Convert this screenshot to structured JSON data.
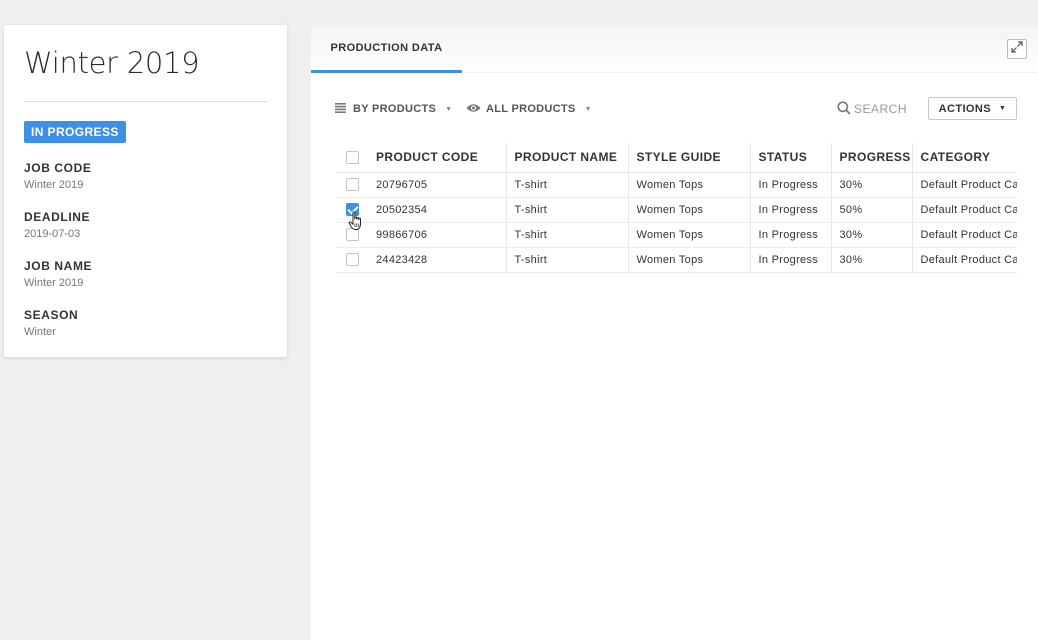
{
  "job": {
    "title": "Winter 2019",
    "status": "IN PROGRESS",
    "fields": [
      {
        "label": "JOB CODE",
        "value": "Winter 2019"
      },
      {
        "label": "DEADLINE",
        "value": "2019-07-03"
      },
      {
        "label": "JOB NAME",
        "value": "Winter 2019"
      },
      {
        "label": "SEASON",
        "value": "Winter"
      }
    ]
  },
  "tabs": [
    {
      "label": "PRODUCTION DATA"
    }
  ],
  "toolbar": {
    "group_by": "BY PRODUCTS",
    "filter": "ALL PRODUCTS",
    "search_label": "SEARCH",
    "actions_label": "ACTIONS"
  },
  "table": {
    "columns": [
      "PRODUCT CODE",
      "PRODUCT NAME",
      "STYLE GUIDE",
      "STATUS",
      "PROGRESS",
      "CATEGORY"
    ],
    "rows": [
      {
        "checked": false,
        "cells": [
          "20796705",
          "T-shirt",
          "Women Tops",
          "In Progress",
          "30%",
          "Default Product Category"
        ]
      },
      {
        "checked": true,
        "cells": [
          "20502354",
          "T-shirt",
          "Women Tops",
          "In Progress",
          "50%",
          "Default Product Category"
        ]
      },
      {
        "checked": false,
        "cells": [
          "99866706",
          "T-shirt",
          "Women Tops",
          "In Progress",
          "30%",
          "Default Product Category"
        ]
      },
      {
        "checked": false,
        "cells": [
          "24423428",
          "T-shirt",
          "Women Tops",
          "In Progress",
          "30%",
          "Default Product Category"
        ]
      }
    ]
  },
  "icons": {
    "expand": "expand-icon",
    "list": "list-icon",
    "eye": "eye-icon",
    "search": "search-icon",
    "cursor": "hand-cursor-icon"
  },
  "colors": {
    "accent": "#3d8fe8",
    "background": "#efefef"
  }
}
